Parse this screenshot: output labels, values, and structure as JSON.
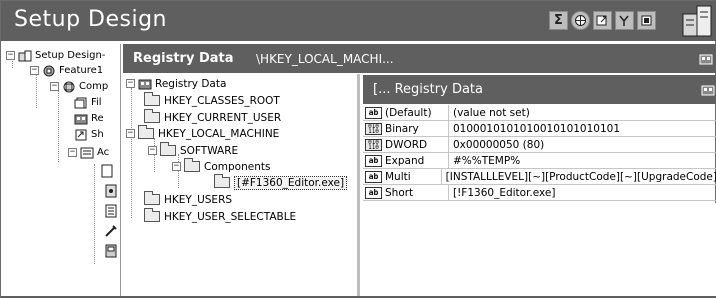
{
  "app": {
    "title": "Setup Design"
  },
  "header_icons": [
    "sigma-icon",
    "globe-icon",
    "shortcut-icon",
    "merge-icon",
    "file-icon"
  ],
  "left_tree": {
    "root": "Setup Design-",
    "feature": "Feature1",
    "component": "Comp",
    "children": [
      "Fil",
      "Re",
      "Sh",
      "Ac"
    ]
  },
  "mid_header": {
    "title": "Registry Data",
    "path": "\\HKEY_LOCAL_MACHI..."
  },
  "registry_tree": {
    "root": "Registry Data",
    "keys": [
      "HKEY_CLASSES_ROOT",
      "HKEY_CURRENT_USER",
      "HKEY_LOCAL_MACHINE",
      "HKEY_USERS",
      "HKEY_USER_SELECTABLE"
    ],
    "software": "SOFTWARE",
    "components": "Components",
    "selected": "[#F1360_Editor.exe]"
  },
  "values_panel": {
    "title": "[...  Registry Data",
    "rows": [
      {
        "name": "(Default)",
        "data": "(value not set)",
        "type": "string"
      },
      {
        "name": "Binary",
        "data": "0100010101010010101010101",
        "type": "binary"
      },
      {
        "name": "DWORD",
        "data": "0x00000050 (80)",
        "type": "binary"
      },
      {
        "name": "Expand",
        "data": "#%%TEMP%",
        "type": "string"
      },
      {
        "name": "Multi",
        "data": "[INSTALLLEVEL][~][ProductCode][~][UpgradeCode]",
        "type": "string"
      },
      {
        "name": "Short",
        "data": "[!F1360_Editor.exe]",
        "type": "string"
      }
    ]
  },
  "colors": {
    "header_bg": "#5f5f5f",
    "header_text": "#ffffff"
  }
}
